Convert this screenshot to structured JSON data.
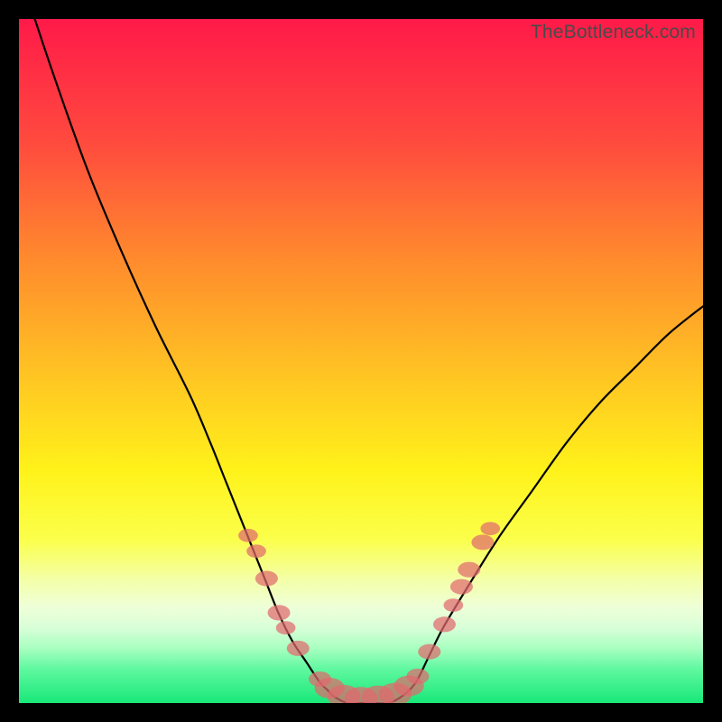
{
  "watermark": "TheBottleneck.com",
  "chart_data": {
    "type": "line",
    "title": "",
    "xlabel": "",
    "ylabel": "",
    "xlim": [
      0,
      100
    ],
    "ylim": [
      0,
      100
    ],
    "series": [
      {
        "name": "bottleneck-curve",
        "x": [
          1,
          5,
          10,
          15,
          20,
          25,
          28,
          30,
          32,
          34,
          36,
          38,
          40,
          42,
          44,
          45,
          46,
          48,
          50,
          52,
          54,
          56,
          58,
          60,
          62,
          65,
          70,
          75,
          80,
          85,
          90,
          95,
          100
        ],
        "y": [
          104,
          92,
          78,
          66,
          55,
          45,
          38,
          33,
          28,
          23,
          18,
          13,
          9,
          6,
          3,
          2,
          1,
          0,
          0,
          0,
          0,
          1,
          3,
          7,
          11,
          16,
          24,
          31,
          38,
          44,
          49,
          54,
          58
        ]
      }
    ],
    "markers": {
      "name": "narrowing-dots",
      "points": [
        {
          "x": 33.5,
          "y": 24.5,
          "r": 1.3
        },
        {
          "x": 34.7,
          "y": 22.2,
          "r": 1.3
        },
        {
          "x": 36.2,
          "y": 18.2,
          "r": 1.5
        },
        {
          "x": 38.0,
          "y": 13.2,
          "r": 1.5
        },
        {
          "x": 39.0,
          "y": 11.0,
          "r": 1.3
        },
        {
          "x": 40.8,
          "y": 8.0,
          "r": 1.5
        },
        {
          "x": 44.0,
          "y": 3.5,
          "r": 1.5
        },
        {
          "x": 45.4,
          "y": 2.2,
          "r": 2.0
        },
        {
          "x": 47.5,
          "y": 1.0,
          "r": 2.2
        },
        {
          "x": 50.0,
          "y": 0.7,
          "r": 2.2
        },
        {
          "x": 52.5,
          "y": 0.9,
          "r": 2.2
        },
        {
          "x": 55.0,
          "y": 1.3,
          "r": 2.2
        },
        {
          "x": 57.0,
          "y": 2.5,
          "r": 2.0
        },
        {
          "x": 58.3,
          "y": 3.9,
          "r": 1.5
        },
        {
          "x": 60.0,
          "y": 7.5,
          "r": 1.5
        },
        {
          "x": 62.2,
          "y": 11.5,
          "r": 1.5
        },
        {
          "x": 63.5,
          "y": 14.3,
          "r": 1.3
        },
        {
          "x": 64.7,
          "y": 17.0,
          "r": 1.5
        },
        {
          "x": 65.8,
          "y": 19.5,
          "r": 1.5
        },
        {
          "x": 67.8,
          "y": 23.5,
          "r": 1.5
        },
        {
          "x": 68.9,
          "y": 25.5,
          "r": 1.3
        }
      ]
    },
    "gradient_stops": [
      {
        "offset": 0,
        "color": "#ff1a49"
      },
      {
        "offset": 18,
        "color": "#ff4a3e"
      },
      {
        "offset": 35,
        "color": "#ff8a2d"
      },
      {
        "offset": 52,
        "color": "#ffc423"
      },
      {
        "offset": 66,
        "color": "#fff21a"
      },
      {
        "offset": 76,
        "color": "#fbff4a"
      },
      {
        "offset": 82,
        "color": "#f4ffa8"
      },
      {
        "offset": 86,
        "color": "#eeffd8"
      },
      {
        "offset": 89,
        "color": "#d8ffd8"
      },
      {
        "offset": 92,
        "color": "#a8ffc0"
      },
      {
        "offset": 95,
        "color": "#60f8a0"
      },
      {
        "offset": 100,
        "color": "#18e878"
      }
    ]
  }
}
